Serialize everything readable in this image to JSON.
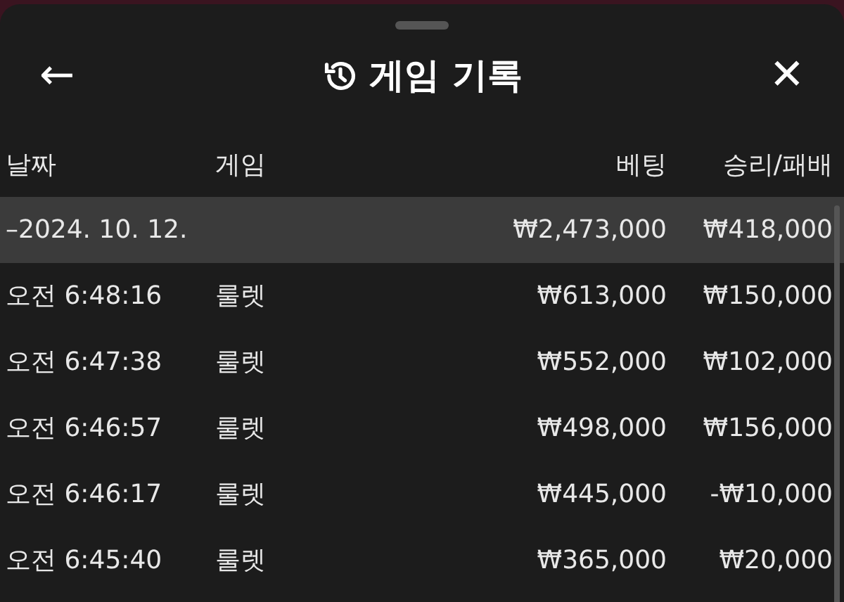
{
  "header": {
    "back": "←",
    "title": "게임 기록",
    "close": "✕"
  },
  "table": {
    "columns": [
      "날짜",
      "게임",
      "베팅",
      "승리/패배"
    ],
    "rows": [
      {
        "kind": "group",
        "date": "–2024. 10. 12.",
        "bet": "₩2,473,000",
        "result": "₩418,000"
      },
      {
        "kind": "entry",
        "time": "오전 6:48:16",
        "game": "룰렛",
        "bet": "₩613,000",
        "result": "₩150,000"
      },
      {
        "kind": "entry",
        "time": "오전 6:47:38",
        "game": "룰렛",
        "bet": "₩552,000",
        "result": "₩102,000"
      },
      {
        "kind": "entry",
        "time": "오전 6:46:57",
        "game": "룰렛",
        "bet": "₩498,000",
        "result": "₩156,000"
      },
      {
        "kind": "entry",
        "time": "오전 6:46:17",
        "game": "룰렛",
        "bet": "₩445,000",
        "result": "-₩10,000"
      },
      {
        "kind": "entry",
        "time": "오전 6:45:40",
        "game": "룰렛",
        "bet": "₩365,000",
        "result": "₩20,000"
      }
    ]
  }
}
